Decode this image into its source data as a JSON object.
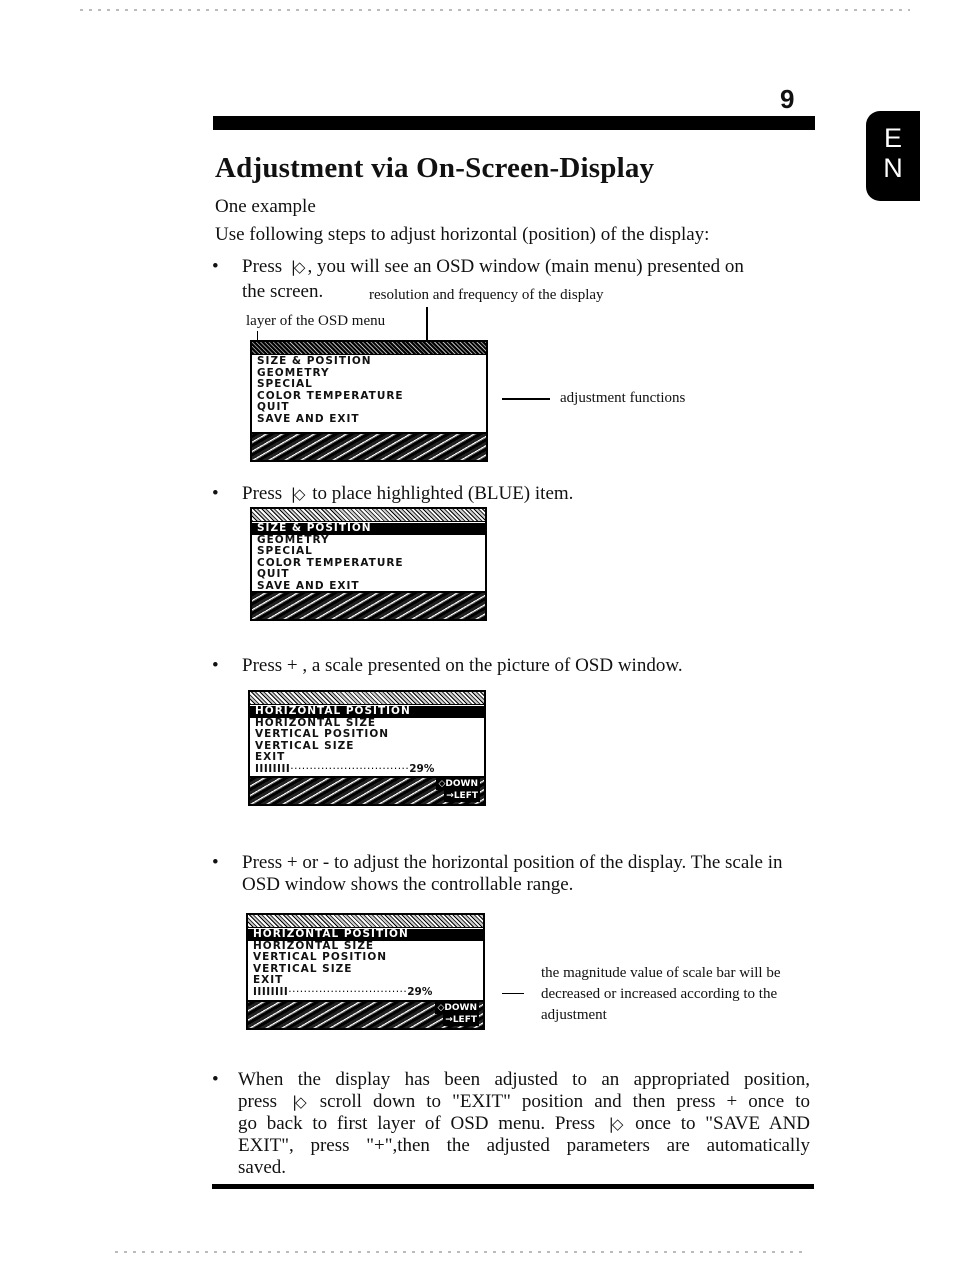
{
  "page": {
    "number": "9",
    "language_tab": [
      "E",
      "N"
    ],
    "title": "Adjustment via On-Screen-Display",
    "intro_1": "One example",
    "intro_2": "Use following steps to adjust horizontal (position) of the display:"
  },
  "icons": {
    "menu_button": "menu-select-button-icon",
    "menu_button_glyph": "|◇"
  },
  "steps": [
    {
      "line1_pre": "Press",
      "line1_post": ", you will see an OSD window (main menu) presented on",
      "line2": "the screen."
    },
    {
      "pre": "Press",
      "post": "to place highlighted (BLUE) item."
    },
    {
      "text": "Press + , a scale presented on the picture of OSD window."
    },
    {
      "text": "Press + or - to adjust the horizontal position of the display. The scale in OSD window shows the controllable range."
    },
    {
      "line1": "When the display has been adjusted to an appropriated position,",
      "line2_pre": "press",
      "line2_post": "scroll down to \"EXIT\" position and then press + once to",
      "line3_pre": "go back to first layer of OSD menu. Press",
      "line3_post": "once to \"SAVE AND",
      "line4": "EXIT\", press \"+\",then the adjusted parameters are automatically",
      "line5": "saved."
    }
  ],
  "annotations": {
    "resolution": "resolution and frequency of the display",
    "layer": "layer of the OSD menu",
    "adjustment_functions": "adjustment functions",
    "scale_note_1": "the magnitude value of scale bar will be",
    "scale_note_2": "decreased or increased according to the",
    "scale_note_3": "adjustment"
  },
  "osd_main_menu": {
    "items": [
      "SIZE & POSITION",
      "GEOMETRY",
      "SPECIAL",
      "COLOR TEMPERATURE",
      "QUIT",
      "SAVE AND EXIT"
    ],
    "highlighted_index_example2": 0
  },
  "osd_size_menu": {
    "items": [
      "HORIZONTAL POSITION",
      "HORIZONTAL SIZE",
      "VERTICAL POSITION",
      "VERTICAL SIZE",
      "EXIT"
    ],
    "highlighted_index": 0,
    "scale_ticks": "IIIIIIII",
    "scale_dots": "·······························",
    "scale_value": "29%",
    "scale_fraction": 0.29,
    "footer_hint_1": "◇DOWN",
    "footer_hint_2": "→LEFT"
  }
}
